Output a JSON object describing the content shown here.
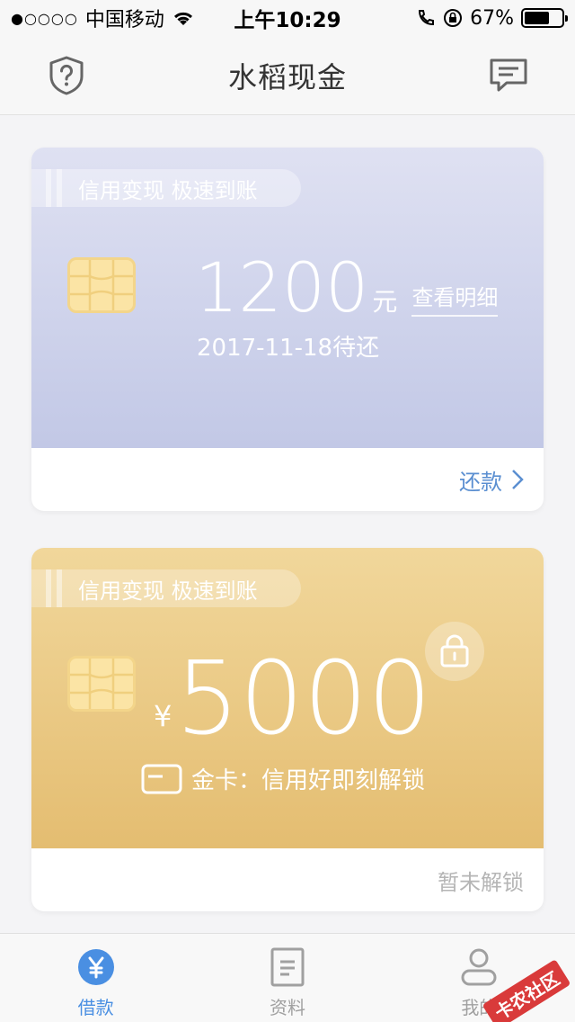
{
  "status_bar": {
    "signal": "●○○○○",
    "carrier": "中国移动",
    "time": "上午10:29",
    "battery": "67%",
    "battery_level": 0.67
  },
  "nav": {
    "title": "水稻现金",
    "left_icon": "help-shield-icon",
    "right_icon": "message-icon"
  },
  "card_blue": {
    "tag": "信用变现 极速到账",
    "amount": "1200",
    "unit": "元",
    "detail_link": "查看明细",
    "due_date": "2017-11-18待还",
    "action": "还款",
    "colors": {
      "top": "#dfe1f2",
      "bottom": "#c2c8e6",
      "action": "#5b8fd1"
    }
  },
  "card_gold": {
    "tag": "信用变现 极速到账",
    "currency": "¥",
    "amount": "5000",
    "note": "金卡：信用好即刻解锁",
    "status": "暂未解锁",
    "colors": {
      "top": "#f1d79b",
      "bottom": "#e4bd71"
    }
  },
  "tab_bar": {
    "items": [
      {
        "label": "借款",
        "icon": "yen-circle-icon",
        "active": true
      },
      {
        "label": "资料",
        "icon": "document-icon",
        "active": false
      },
      {
        "label": "我的",
        "icon": "person-icon",
        "active": false
      }
    ],
    "active_color": "#4a8fe2"
  },
  "watermark": "卡农社区"
}
